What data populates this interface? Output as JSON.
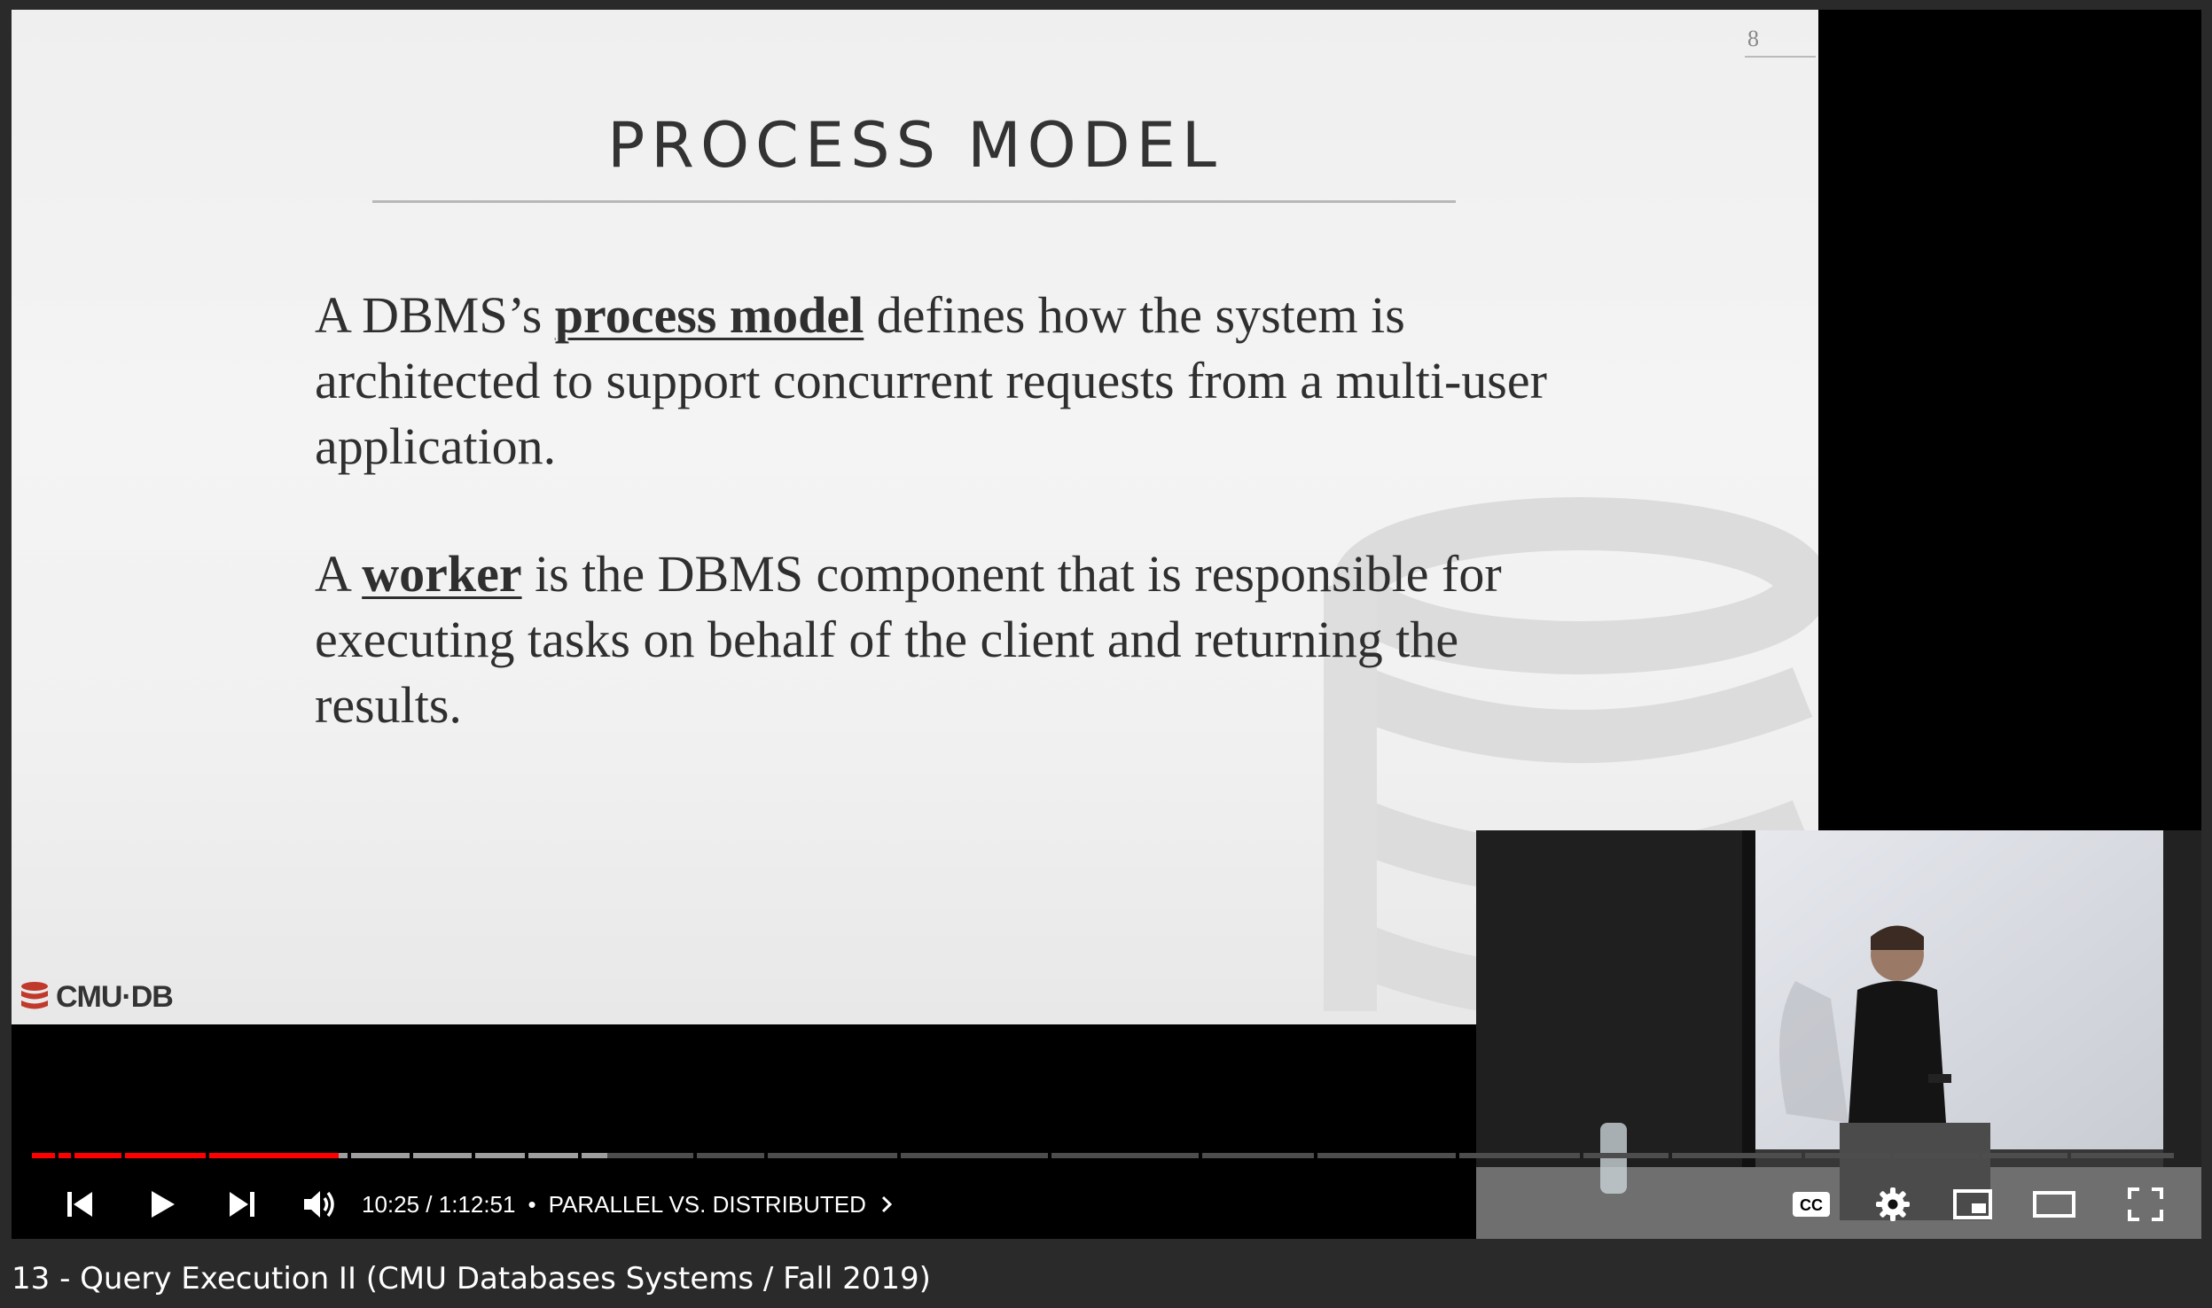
{
  "slide": {
    "number": "8",
    "title": "PROCESS MODEL",
    "paragraph1": {
      "before": "A DBMS’s ",
      "term": "process model",
      "after": " defines how the system is architected to support concurrent requests from a multi-user application."
    },
    "paragraph2": {
      "before": "A ",
      "term": "worker",
      "after": " is the DBMS component that is responsible for executing tasks on behalf of the client and returning the results."
    },
    "logo_text": "CMU·DB"
  },
  "player": {
    "current_time": "10:25",
    "duration": "1:12:51",
    "time_display": "10:25 / 1:12:51",
    "separator": "•",
    "chapter": "PARALLEL VS. DISTRIBUTED",
    "progress_fraction": 0.143,
    "buffered_fraction": 0.125,
    "colors": {
      "played": "#ff0000",
      "buffered": "#9e9e9e",
      "unplayed": "#4d4d4d"
    },
    "icons": [
      "previous-icon",
      "play-icon",
      "next-icon",
      "volume-icon",
      "chevron-right-icon",
      "captions-icon",
      "gear-icon",
      "miniplayer-icon",
      "theater-icon",
      "fullscreen-icon"
    ]
  },
  "video": {
    "title": "13 - Query Execution II (CMU Databases Systems / Fall 2019)"
  }
}
